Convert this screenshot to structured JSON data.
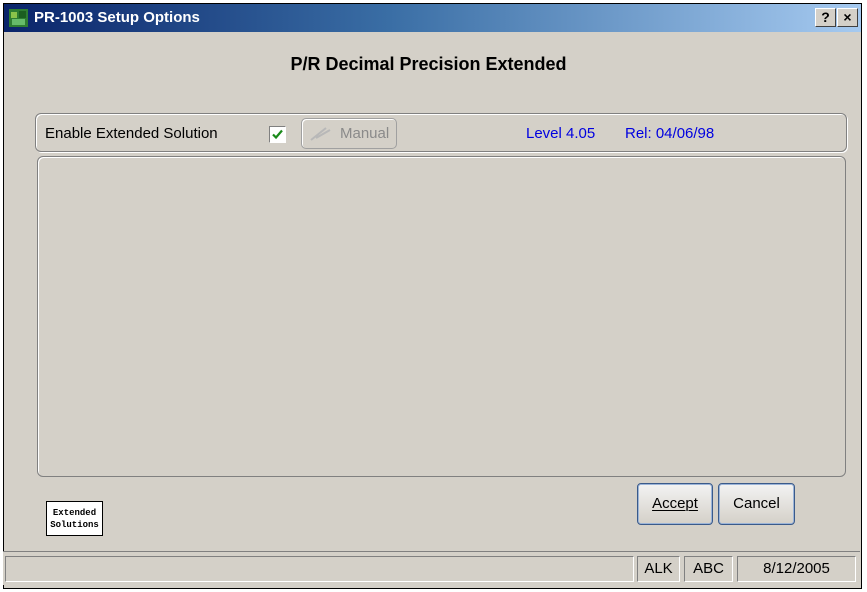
{
  "window": {
    "title": "PR-1003  Setup Options"
  },
  "titlebar_buttons": {
    "help": "?",
    "close": "×"
  },
  "heading": "P/R Decimal Precision Extended",
  "options": {
    "enable_label": "Enable Extended Solution",
    "enable_checked": true,
    "manual_label": "Manual",
    "level": "Level 4.05",
    "release": "Rel: 04/06/98"
  },
  "logo": {
    "line1": "Extended",
    "line2": "Solutions"
  },
  "buttons": {
    "accept": "Accept",
    "cancel": "Cancel"
  },
  "statusbar": {
    "pane1": "",
    "pane2": "ALK",
    "pane3": "ABC",
    "pane4": "8/12/2005"
  },
  "colors": {
    "title_start": "#0a246a",
    "title_end": "#a6caf0",
    "link_blue": "#0000e0",
    "face": "#d4d0c8"
  }
}
